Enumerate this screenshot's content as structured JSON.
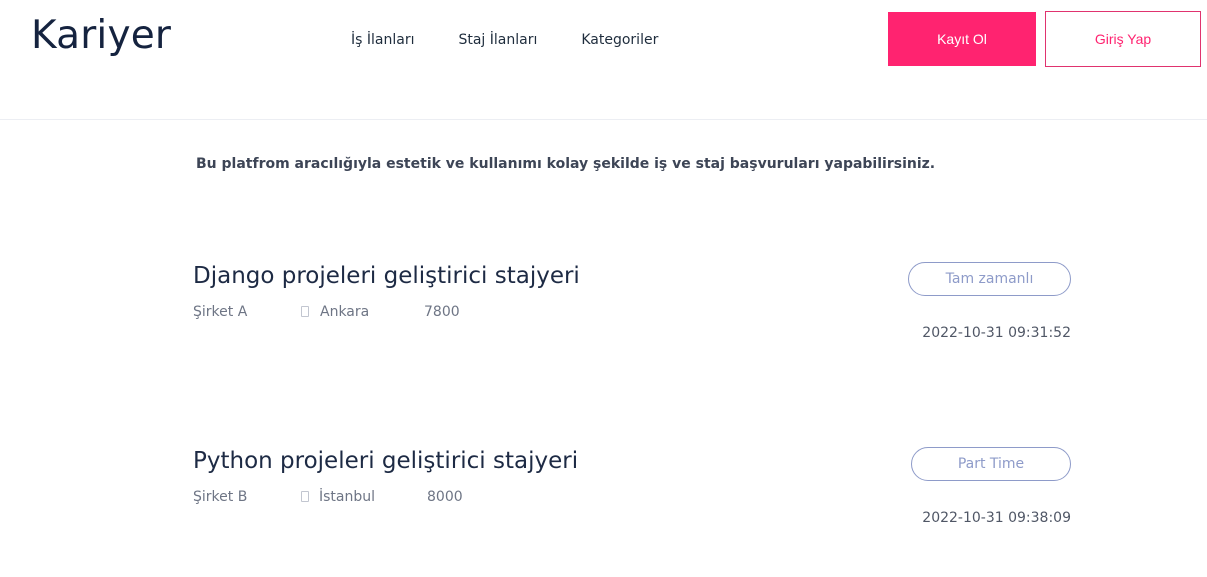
{
  "header": {
    "brand": "Kariyer",
    "nav": [
      {
        "label": "İş İlanları"
      },
      {
        "label": "Staj İlanları"
      },
      {
        "label": "Kategoriler"
      }
    ],
    "register_label": "Kayıt Ol",
    "login_label": "Giriş Yap"
  },
  "intro": "Bu platfrom aracılığıyla estetik ve kullanımı kolay şekilde iş ve staj başvuruları yapabilirsiniz.",
  "jobs": [
    {
      "title": "Django projeleri geliştirici stajyeri",
      "company": "Şirket A",
      "location_icon": "location-icon",
      "location": "Ankara",
      "salary": "7800",
      "type": "Tam zamanlı",
      "date": "2022-10-31 09:31:52"
    },
    {
      "title": "Python projeleri geliştirici stajyeri",
      "company": "Şirket B",
      "location_icon": "location-icon",
      "location": "İstanbul",
      "salary": "8000",
      "type": "Part Time",
      "date": "2022-10-31 09:38:09"
    }
  ],
  "colors": {
    "accent": "#ff2370",
    "badge": "#8e9bc9",
    "brand_text": "#15233f"
  }
}
